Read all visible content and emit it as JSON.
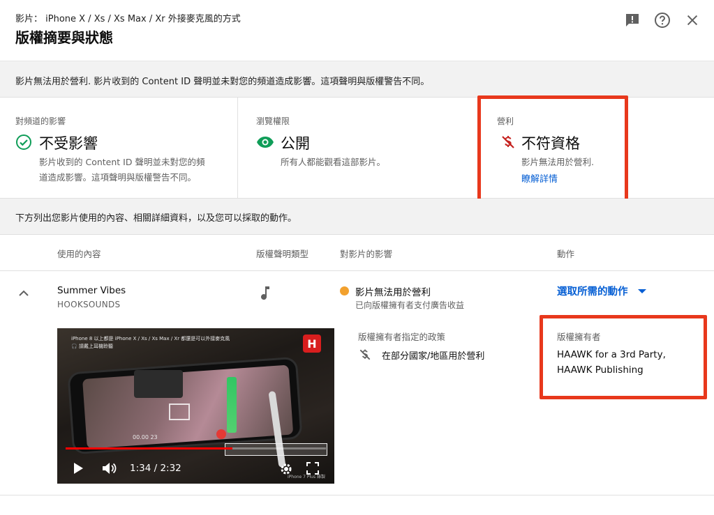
{
  "header": {
    "video_title": "影片： iPhone X / Xs / Xs Max / Xr 外接麥克風的方式",
    "page_title": "版權摘要與狀態",
    "icons": [
      "feedback-icon",
      "help-icon",
      "close-icon"
    ]
  },
  "banner": {
    "text": "影片無法用於營利. 影片收到的 Content ID 聲明並未對您的頻道造成影響。這項聲明與版權警告不同。"
  },
  "impact": {
    "channel": {
      "label": "對頻道的影響",
      "status": "不受影響",
      "desc_line1": "影片收到的 Content ID 聲明並未對您的頻",
      "desc_line2": "道造成影響。這項聲明與版權警告不同。",
      "icon": "check-circle-icon",
      "color": "#0f9d58"
    },
    "visibility": {
      "label": "瀏覽權限",
      "status": "公開",
      "desc": "所有人都能觀看這部影片。",
      "icon": "eye-icon",
      "color": "#0f9d58"
    },
    "monetization": {
      "label": "營利",
      "status": "不符資格",
      "desc": "影片無法用於營利.",
      "link": "瞭解詳情",
      "icon": "no-money-icon",
      "color": "#c5221f"
    }
  },
  "subbanner": {
    "text": "下方列出您影片使用的內容、相關詳細資料，以及您可以採取的動作。"
  },
  "table": {
    "headers": {
      "content": "使用的內容",
      "claim_type": "版權聲明類型",
      "impact": "對影片的影響",
      "action": "動作"
    },
    "row": {
      "title": "Summer Vibes",
      "artist": "HOOKSOUNDS",
      "claim_icon": "music-note-icon",
      "impact_status": "影片無法用於營利",
      "impact_sub": "已向版權擁有者支付廣告收益",
      "impact_color": "#f2a12e",
      "action_label": "選取所需的動作",
      "policy_label": "版權擁有者指定的政策",
      "policy_text": "在部分國家/地區用於營利",
      "owner_label": "版權擁有者",
      "owner_text": "HAAWK for a 3rd Party, HAAWK Publishing",
      "video": {
        "time": "1:34 / 2:32",
        "progress": 0.64,
        "caption_line1": "iPhone 8 以上都是 iPhone X / Xs / Xs Max / Xr 都還是可以外接麥克風",
        "caption_line2": "🎧 請戴上耳機聆聽",
        "logo": "H",
        "zoom": "00.00  23",
        "watermark": "iPhone 7 Plus 錄製"
      }
    }
  },
  "accent_color": "#065fd4",
  "highlight_color": "#e8381c"
}
